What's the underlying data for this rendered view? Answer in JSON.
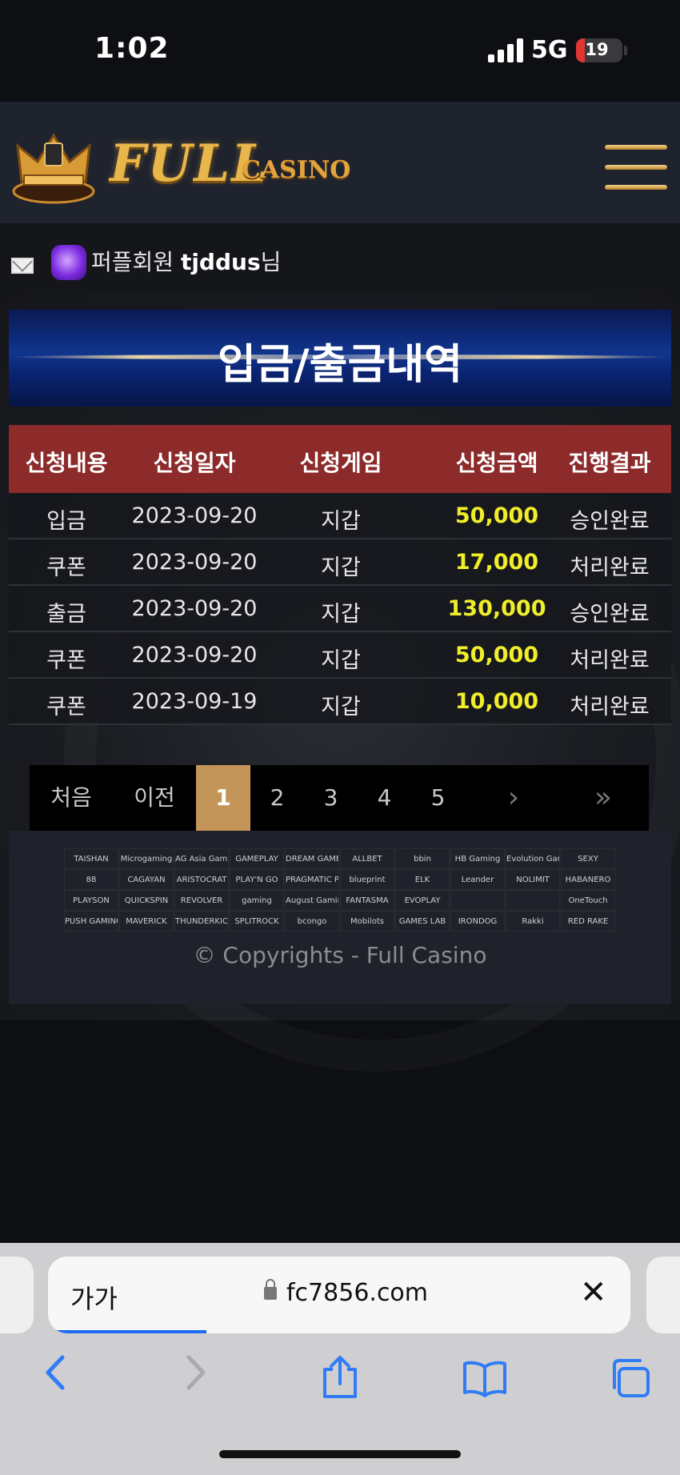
{
  "status": {
    "time": "1:02",
    "network": "5G",
    "battery": "19",
    "battery_level": 0.19
  },
  "header": {
    "logo_main": "FULL",
    "logo_sub": "CASINO"
  },
  "user": {
    "rank": "퍼플회원",
    "name": "tjddus",
    "suffix": "님"
  },
  "page_title": "입금/출금내역",
  "table": {
    "headers": [
      "신청내용",
      "신청일자",
      "신청게임",
      "신청금액",
      "진행결과"
    ],
    "rows": [
      [
        "입금",
        "2023-09-20",
        "지갑",
        "50,000",
        "승인완료"
      ],
      [
        "쿠폰",
        "2023-09-20",
        "지갑",
        "17,000",
        "처리완료"
      ],
      [
        "출금",
        "2023-09-20",
        "지갑",
        "130,000",
        "승인완료"
      ],
      [
        "쿠폰",
        "2023-09-20",
        "지갑",
        "50,000",
        "처리완료"
      ],
      [
        "쿠폰",
        "2023-09-19",
        "지갑",
        "10,000",
        "처리완료"
      ]
    ]
  },
  "pagination": {
    "first": "처음",
    "prev": "이전",
    "pages": [
      "1",
      "2",
      "3",
      "4",
      "5"
    ],
    "active": "1",
    "next": "›",
    "last": "»"
  },
  "providers": [
    "TAISHAN",
    "Microgaming",
    "AG Asia Gaming",
    "GAMEPLAY",
    "DREAM GAME",
    "ALLBET",
    "bbin",
    "HB Gaming",
    "Evolution Gaming",
    "SEXY",
    "88",
    "CAGAYAN",
    "ARISTOCRAT",
    "PLAY'N GO",
    "PRAGMATIC PLAY",
    "blueprint",
    "ELK",
    "Leander",
    "NOLIMIT",
    "HABANERO",
    "PLAYSON",
    "QUICKSPIN",
    "REVOLVER",
    "gaming",
    "August Gaming",
    "FANTASMA",
    "EVOPLAY",
    "",
    "",
    "OneTouch",
    "PUSH GAMING",
    "MAVERICK",
    "THUNDERKICK",
    "SPLITROCK",
    "bcongo",
    "Mobilots",
    "GAMES LAB",
    "IRONDOG",
    "Rakki",
    "RED RAKE"
  ],
  "copyright": "© Copyrights - Full Casino",
  "browser": {
    "aa": "가가",
    "url": "fc7856.com",
    "close": "✕"
  },
  "colors": {
    "accent_gold": "#c49558",
    "table_header": "#8d2a2a",
    "amount": "#f0ee2a",
    "title_blue": "#10348d"
  }
}
